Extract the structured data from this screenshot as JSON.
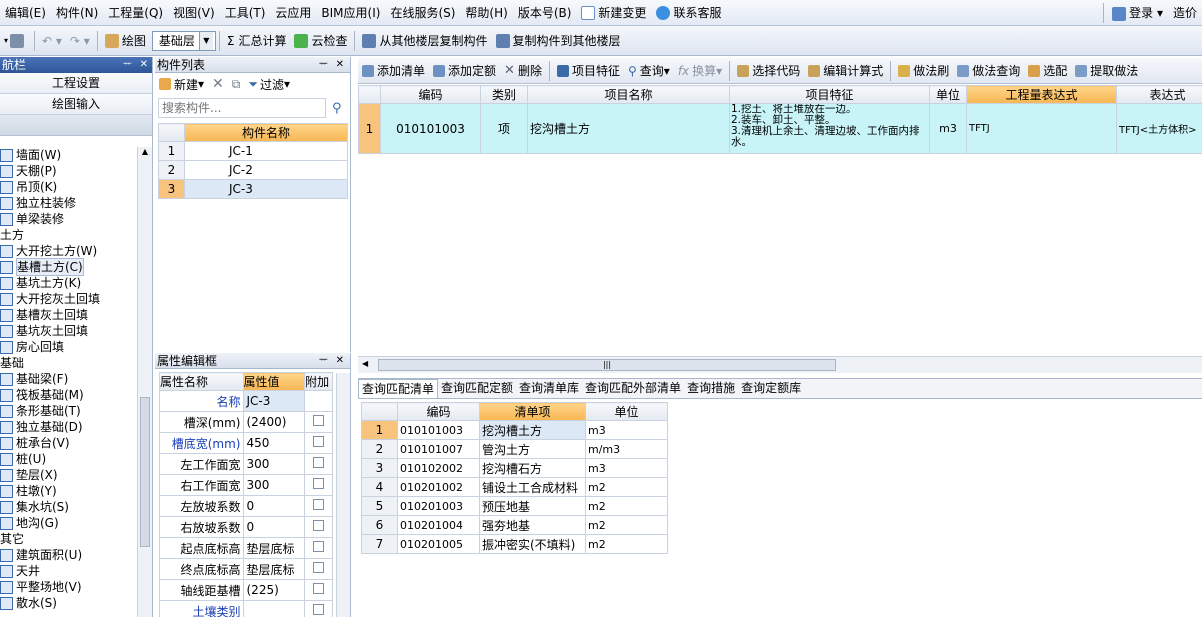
{
  "menu": {
    "items": [
      "编辑(E)",
      "构件(N)",
      "工程量(Q)",
      "视图(V)",
      "工具(T)",
      "云应用",
      "BIM应用(I)",
      "在线服务(S)",
      "帮助(H)",
      "版本号(B)"
    ],
    "new_change": "新建变更",
    "support": "联系客服",
    "login": "登录",
    "cost": "造价"
  },
  "toolbar": {
    "draw": "绘图",
    "layer": "基础层",
    "sum": "汇总计算",
    "cloud_check": "云检查",
    "copy_from": "从其他楼层复制构件",
    "copy_to": "复制构件到其他楼层"
  },
  "nav": {
    "title": "航栏",
    "project_settings": "工程设置",
    "drawing_input": "绘图输入",
    "tree": [
      {
        "label": "墙面(W)",
        "cat": false
      },
      {
        "label": "天棚(P)",
        "cat": false
      },
      {
        "label": "吊顶(K)",
        "cat": false
      },
      {
        "label": "独立柱装修",
        "cat": false
      },
      {
        "label": "单梁装修",
        "cat": false
      },
      {
        "label": "土方",
        "cat": true
      },
      {
        "label": "大开挖土方(W)",
        "cat": false
      },
      {
        "label": "基槽土方(C)",
        "cat": false,
        "sel": true
      },
      {
        "label": "基坑土方(K)",
        "cat": false
      },
      {
        "label": "大开挖灰土回填",
        "cat": false
      },
      {
        "label": "基槽灰土回填",
        "cat": false
      },
      {
        "label": "基坑灰土回填",
        "cat": false
      },
      {
        "label": "房心回填",
        "cat": false
      },
      {
        "label": "基础",
        "cat": true
      },
      {
        "label": "基础梁(F)",
        "cat": false
      },
      {
        "label": "筏板基础(M)",
        "cat": false
      },
      {
        "label": "条形基础(T)",
        "cat": false
      },
      {
        "label": "独立基础(D)",
        "cat": false
      },
      {
        "label": "桩承台(V)",
        "cat": false
      },
      {
        "label": "桩(U)",
        "cat": false
      },
      {
        "label": "垫层(X)",
        "cat": false
      },
      {
        "label": "柱墩(Y)",
        "cat": false
      },
      {
        "label": "集水坑(S)",
        "cat": false
      },
      {
        "label": "地沟(G)",
        "cat": false
      },
      {
        "label": "其它",
        "cat": true
      },
      {
        "label": "建筑面积(U)",
        "cat": false
      },
      {
        "label": "天井",
        "cat": false
      },
      {
        "label": "平整场地(V)",
        "cat": false
      },
      {
        "label": "散水(S)",
        "cat": false
      }
    ]
  },
  "component_list": {
    "title": "构件列表",
    "new": "新建",
    "filter": "过滤",
    "search_placeholder": "搜索构件...",
    "header": "构件名称",
    "rows": [
      {
        "n": "1",
        "name": "JC-1"
      },
      {
        "n": "2",
        "name": "JC-2"
      },
      {
        "n": "3",
        "name": "JC-3"
      }
    ]
  },
  "properties": {
    "title": "属性编辑框",
    "h_name": "属性名称",
    "h_value": "属性值",
    "h_extra": "附加",
    "rows": [
      {
        "name": "名称",
        "value": "JC-3",
        "blue": true,
        "cb": false
      },
      {
        "name": "槽深(mm)",
        "value": "(2400)",
        "blue": false,
        "cb": true
      },
      {
        "name": "槽底宽(mm)",
        "value": "450",
        "blue": true,
        "cb": true
      },
      {
        "name": "左工作面宽",
        "value": "300",
        "blue": false,
        "cb": true
      },
      {
        "name": "右工作面宽",
        "value": "300",
        "blue": false,
        "cb": true
      },
      {
        "name": "左放坡系数",
        "value": "0",
        "blue": false,
        "cb": true
      },
      {
        "name": "右放坡系数",
        "value": "0",
        "blue": false,
        "cb": true
      },
      {
        "name": "起点底标高",
        "value": "垫层底标",
        "blue": false,
        "cb": true
      },
      {
        "name": "终点底标高",
        "value": "垫层底标",
        "blue": false,
        "cb": true
      },
      {
        "name": "轴线距基槽",
        "value": "(225)",
        "blue": false,
        "cb": true
      },
      {
        "name": "土壤类别",
        "value": "",
        "blue": true,
        "cb": true
      }
    ]
  },
  "list_toolbar": {
    "add_list": "添加清单",
    "add_quota": "添加定额",
    "delete": "删除",
    "item_feature": "项目特征",
    "query": "查询",
    "convert": "换算",
    "select_code": "选择代码",
    "edit_formula": "编辑计算式",
    "method_brush": "做法刷",
    "method_query": "做法查询",
    "match": "选配",
    "extract": "提取做法"
  },
  "main_table": {
    "headers": [
      "编码",
      "类别",
      "项目名称",
      "项目特征",
      "单位",
      "工程量表达式",
      "表达式"
    ],
    "rows": [
      {
        "n": "1",
        "code": "010101003",
        "type": "项",
        "name": "挖沟槽土方",
        "feature": "1.挖土、将土堆放在一边。\n2.装车、卸土、平整。\n3.清理机上余土、清理边坡、工作面内排水。",
        "unit": "m3",
        "expr": "TFTJ",
        "expr2": "TFTJ<土方体积>"
      }
    ]
  },
  "bottom_tabs": [
    "查询匹配清单",
    "查询匹配定额",
    "查询清单库",
    "查询匹配外部清单",
    "查询措施",
    "查询定额库"
  ],
  "match_table": {
    "headers": [
      "编码",
      "清单项",
      "单位"
    ],
    "rows": [
      {
        "n": "1",
        "code": "010101003",
        "name": "挖沟槽土方",
        "unit": "m3"
      },
      {
        "n": "2",
        "code": "010101007",
        "name": "管沟土方",
        "unit": "m/m3"
      },
      {
        "n": "3",
        "code": "010102002",
        "name": "挖沟槽石方",
        "unit": "m3"
      },
      {
        "n": "4",
        "code": "010201002",
        "name": "铺设土工合成材料",
        "unit": "m2"
      },
      {
        "n": "5",
        "code": "010201003",
        "name": "预压地基",
        "unit": "m2"
      },
      {
        "n": "6",
        "code": "010201004",
        "name": "强夯地基",
        "unit": "m2"
      },
      {
        "n": "7",
        "code": "010201005",
        "name": "振冲密实(不填料)",
        "unit": "m2"
      }
    ]
  },
  "colors": {
    "accent": "#2d5598",
    "selected": "#f8c37c",
    "row_cyan": "#c8f4f8"
  }
}
